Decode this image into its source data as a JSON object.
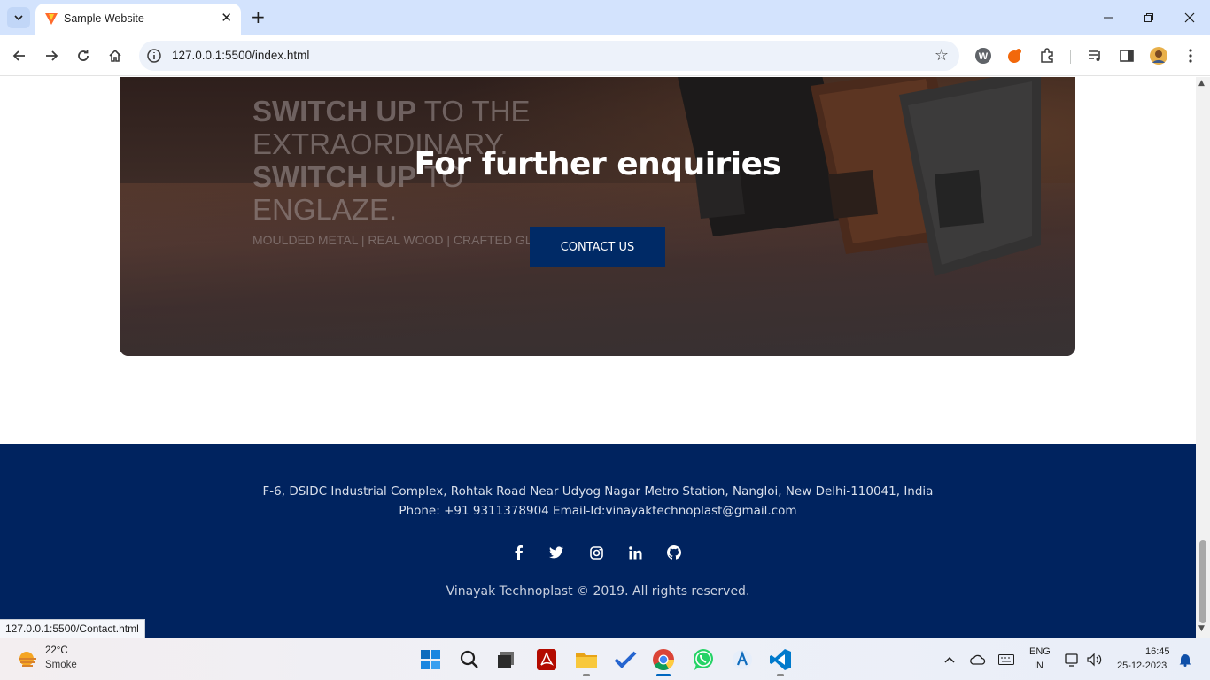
{
  "browser": {
    "tab_title": "Sample Website",
    "url": "127.0.0.1:5500/index.html",
    "status_url": "127.0.0.1:5500/Contact.html"
  },
  "banner": {
    "ad_line1_bold": "SWITCH UP",
    "ad_line1_rest": " TO THE",
    "ad_line1b": "EXTRAORDINARY.",
    "ad_line2_bold": "SWITCH UP",
    "ad_line2_rest": " TO",
    "ad_line2b": "ENGLAZE.",
    "ad_tagline": "MOULDED METAL | REAL WOOD | CRAFTED GLA",
    "title": "For further enquiries",
    "button_label": "CONTACT US"
  },
  "footer": {
    "address": "F-6, DSIDC Industrial Complex, Rohtak Road Near Udyog Nagar Metro Station, Nangloi, New Delhi-110041, India",
    "contact": "Phone: +91 9311378904 Email-Id:vinayaktechnoplast@gmail.com",
    "copyright": "Vinayak Technoplast © 2019. All rights reserved.",
    "social": [
      "facebook-icon",
      "twitter-icon",
      "instagram-icon",
      "linkedin-icon",
      "github-icon"
    ]
  },
  "taskbar": {
    "weather_temp": "22°C",
    "weather_desc": "Smoke",
    "lang1": "ENG",
    "lang2": "IN",
    "time": "16:45",
    "date": "25-12-2023"
  },
  "colors": {
    "footer_bg": "#00235f",
    "button_bg": "#002a66",
    "tabstrip_bg": "#d3e3fd"
  }
}
